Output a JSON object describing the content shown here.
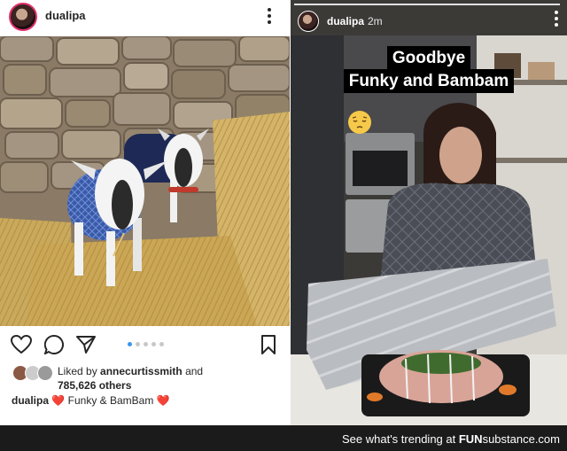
{
  "post": {
    "username": "dualipa",
    "likes_prefix": "Liked by ",
    "likes_user": "annecurtissmith",
    "likes_and": " and",
    "likes_count": "785,626 others",
    "caption_user": "dualipa",
    "caption_heart": "❤️",
    "caption_text": " Funky & BamBam ",
    "caption_heart_end": "❤️",
    "carousel_total": 5,
    "carousel_active": 1,
    "icons": [
      "heart-icon",
      "comment-icon",
      "share-icon",
      "bookmark-icon",
      "more-icon"
    ]
  },
  "story": {
    "username": "dualipa",
    "time": "2m",
    "caption_line1": "Goodbye",
    "caption_line2": "Funky and Bambam",
    "sticker": "pensive-face-emoji"
  },
  "banner": {
    "text": "See what's trending at ",
    "brand_strong": "FUN",
    "brand_rest": "substance.com"
  },
  "colors": {
    "story_ring": "#e1306c",
    "carousel_active": "#3897f0",
    "banner_bg": "#1b1b1b"
  }
}
